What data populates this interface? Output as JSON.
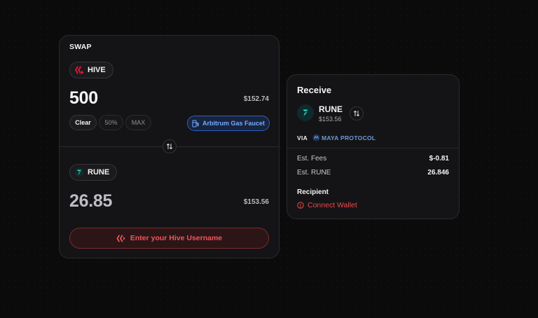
{
  "swap": {
    "title": "SWAP",
    "from": {
      "token": "HIVE",
      "amount": "500",
      "usd": "$152.74"
    },
    "quick_buttons": [
      "Clear",
      "50%",
      "MAX"
    ],
    "faucet_label": "Arbitrum Gas Faucet",
    "to": {
      "token": "RUNE",
      "amount": "26.85",
      "usd": "$153.56"
    },
    "cta_label": "Enter your Hive Username"
  },
  "receive": {
    "title": "Receive",
    "token": "RUNE",
    "usd": "$153.56",
    "via_label": "VIA",
    "via_name": "MAYA PROTOCOL",
    "rows": [
      {
        "label": "Est. Fees",
        "value": "$-0.81"
      },
      {
        "label": "Est. RUNE",
        "value": "26.846"
      }
    ],
    "recipient_label": "Recipient",
    "connect_label": "Connect Wallet"
  },
  "colors": {
    "hive_red": "#e31337",
    "rune_teal": "#33d6c0",
    "accent_blue": "#78a8ff",
    "danger_red": "#f0565a"
  },
  "icons": [
    "hive-logo-icon",
    "rune-logo-icon",
    "gas-pump-icon",
    "swap-arrows-icon",
    "maya-logo-icon",
    "alert-circle-icon"
  ]
}
